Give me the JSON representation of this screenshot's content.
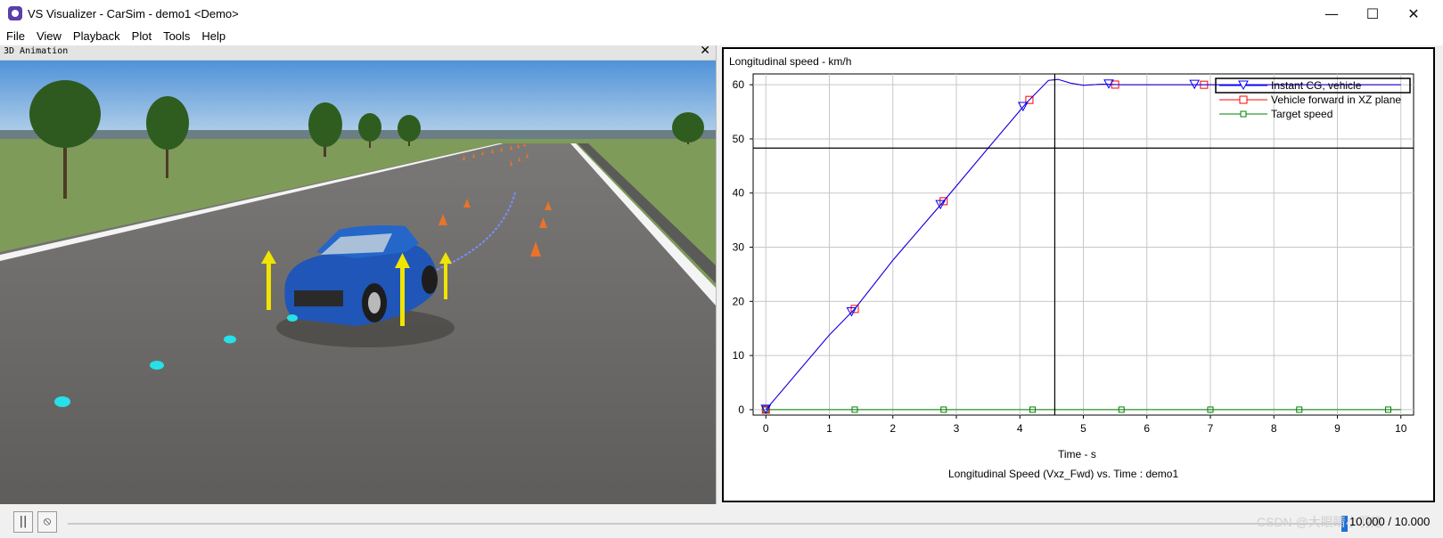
{
  "window": {
    "title": "VS Visualizer - CarSim - demo1 <Demo>",
    "minimize_glyph": "—",
    "maximize_glyph": "☐",
    "close_glyph": "✕"
  },
  "menu": [
    "File",
    "View",
    "Playback",
    "Plot",
    "Tools",
    "Help"
  ],
  "animation_panel": {
    "title": "3D Animation",
    "close_glyph": "✕",
    "colors": {
      "sky": "#6aa6dd",
      "grass": "#7d9a58",
      "road": "#6f6d6b",
      "car": "#1f56b8",
      "cone": "#e8732a",
      "marker": "#27e0e8",
      "arrow": "#f1e400"
    }
  },
  "plot_panel": {
    "title": "Longitudinal speed - km/h",
    "caption": "Longitudinal Speed (Vxz_Fwd) vs. Time : demo1",
    "xlabel": "Time - s"
  },
  "chart_data": {
    "type": "line",
    "title": "Longitudinal speed - km/h",
    "xlabel": "Time - s",
    "ylabel": "",
    "xlim": [
      -0.2,
      10.2
    ],
    "ylim": [
      -1,
      62
    ],
    "x_ticks": [
      0,
      1,
      2,
      3,
      4,
      5,
      6,
      7,
      8,
      9,
      10
    ],
    "y_ticks": [
      0,
      10,
      20,
      30,
      40,
      50,
      60
    ],
    "grid": true,
    "legend_position": "top-right",
    "crosshair": {
      "x": 4.55,
      "y": 48.3
    },
    "series": [
      {
        "name": "Instant CG, vehicle",
        "color": "#0000ff",
        "marker": "triangle-down",
        "x": [
          0,
          0.5,
          1.0,
          1.4,
          2.0,
          2.75,
          3.5,
          4.1,
          4.45,
          4.6,
          4.8,
          5.0,
          5.3,
          5.6,
          6.0,
          7.0,
          8.0,
          9.0,
          10.0
        ],
        "y": [
          0,
          6.9,
          13.8,
          18.6,
          27.6,
          37.8,
          48.3,
          56.6,
          60.8,
          61.0,
          60.3,
          59.9,
          60.1,
          60.0,
          60.0,
          60.0,
          60.0,
          60.0,
          60.0
        ],
        "marker_x": [
          0,
          1.35,
          2.75,
          4.05,
          5.4,
          6.75
        ]
      },
      {
        "name": "Vehicle forward in XZ plane",
        "color": "#ff0000",
        "marker": "square",
        "x": [
          0,
          0.5,
          1.0,
          1.4,
          2.0,
          2.75,
          3.5,
          4.1,
          4.45,
          4.6,
          4.8,
          5.0,
          5.3,
          5.6,
          6.0,
          7.0,
          8.0,
          9.0,
          10.0
        ],
        "y": [
          0,
          6.9,
          13.8,
          18.6,
          27.6,
          37.8,
          48.3,
          56.6,
          60.8,
          61.0,
          60.3,
          59.9,
          60.1,
          60.0,
          60.0,
          60.0,
          60.0,
          60.0,
          60.0
        ],
        "marker_x": [
          0,
          1.4,
          2.8,
          4.15,
          5.5,
          6.9
        ]
      },
      {
        "name": "Target speed",
        "color": "#008000",
        "marker": "square",
        "x": [
          0,
          10
        ],
        "y": [
          0,
          0
        ],
        "marker_x": [
          0,
          1.4,
          2.8,
          4.2,
          5.6,
          7.0,
          8.4,
          9.8
        ]
      }
    ]
  },
  "playback": {
    "pause_glyph": "||",
    "loop_glyph": "⦸",
    "time_readout": "10.000 / 10.000",
    "progress": 1.0
  },
  "watermark": "CSDN @大眼睛小羽翅"
}
